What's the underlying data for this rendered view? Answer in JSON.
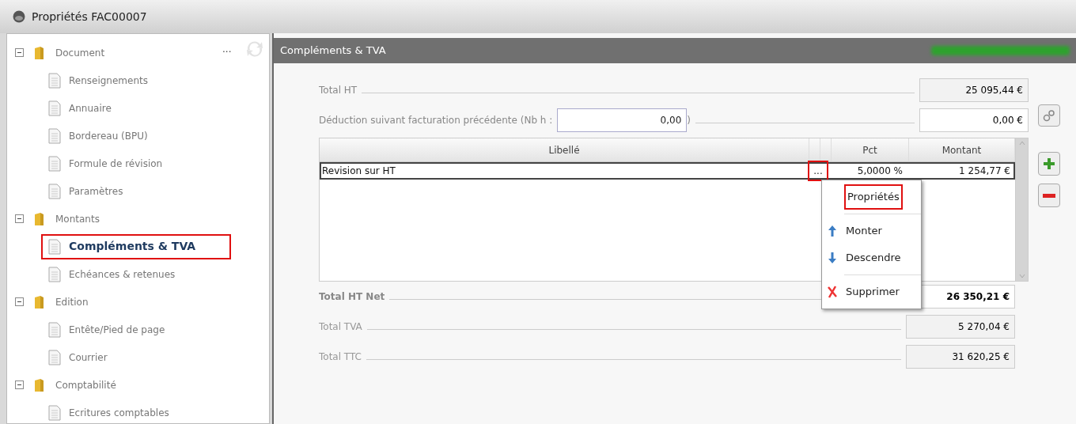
{
  "window": {
    "title": "Propriétés FAC00007"
  },
  "tree": {
    "more_button": "...",
    "items": [
      {
        "label": "Document",
        "expanded": true,
        "children": [
          {
            "label": "Renseignements",
            "selected": false,
            "highlighted": false
          },
          {
            "label": "Annuaire",
            "selected": false,
            "highlighted": false
          },
          {
            "label": "Bordereau (BPU)",
            "selected": false,
            "highlighted": false
          },
          {
            "label": "Formule de révision",
            "selected": false,
            "highlighted": false
          },
          {
            "label": "Paramètres",
            "selected": false,
            "highlighted": false
          }
        ]
      },
      {
        "label": "Montants",
        "expanded": true,
        "children": [
          {
            "label": "Compléments & TVA",
            "selected": true,
            "highlighted": true
          },
          {
            "label": "Echéances & retenues",
            "selected": false,
            "highlighted": false
          }
        ]
      },
      {
        "label": "Edition",
        "expanded": true,
        "children": [
          {
            "label": "Entête/Pied de page",
            "selected": false,
            "highlighted": false
          },
          {
            "label": "Courrier",
            "selected": false,
            "highlighted": false
          }
        ]
      },
      {
        "label": "Comptabilité",
        "expanded": true,
        "children": [
          {
            "label": "Ecritures comptables",
            "selected": false,
            "highlighted": false
          }
        ]
      }
    ]
  },
  "panel": {
    "title": "Compléments & TVA",
    "total_ht": {
      "label": "Total HT",
      "value": "25 095,44 €"
    },
    "deduction": {
      "label": "Déduction suivant facturation précédente (Nb h :",
      "hours": "0,00",
      "close": ")",
      "value": "0,00 €"
    },
    "table": {
      "columns": [
        "Libellé",
        "",
        "",
        "Pct",
        "Montant"
      ],
      "rows": [
        {
          "libelle": "Revision sur HT",
          "more": "...",
          "highlighted": true,
          "pct": "5,0000 %",
          "montant": "1 254,77 €",
          "selected": true
        }
      ]
    },
    "context_menu": [
      {
        "kind": "item",
        "label": "Propriétés",
        "highlighted": true
      },
      {
        "kind": "separator"
      },
      {
        "kind": "up",
        "label": "Monter",
        "highlighted": false
      },
      {
        "kind": "down",
        "label": "Descendre",
        "highlighted": false
      },
      {
        "kind": "separator"
      },
      {
        "kind": "delete",
        "label": "Supprimer",
        "highlighted": false
      }
    ],
    "totals": [
      {
        "label": "Total HT Net",
        "value": "26 350,21 €",
        "emphasis": true
      },
      {
        "label": "Total TVA",
        "value": "5 270,04 €",
        "emphasis": false
      },
      {
        "label": "Total TTC",
        "value": "31 620,25 €",
        "emphasis": false
      }
    ]
  }
}
